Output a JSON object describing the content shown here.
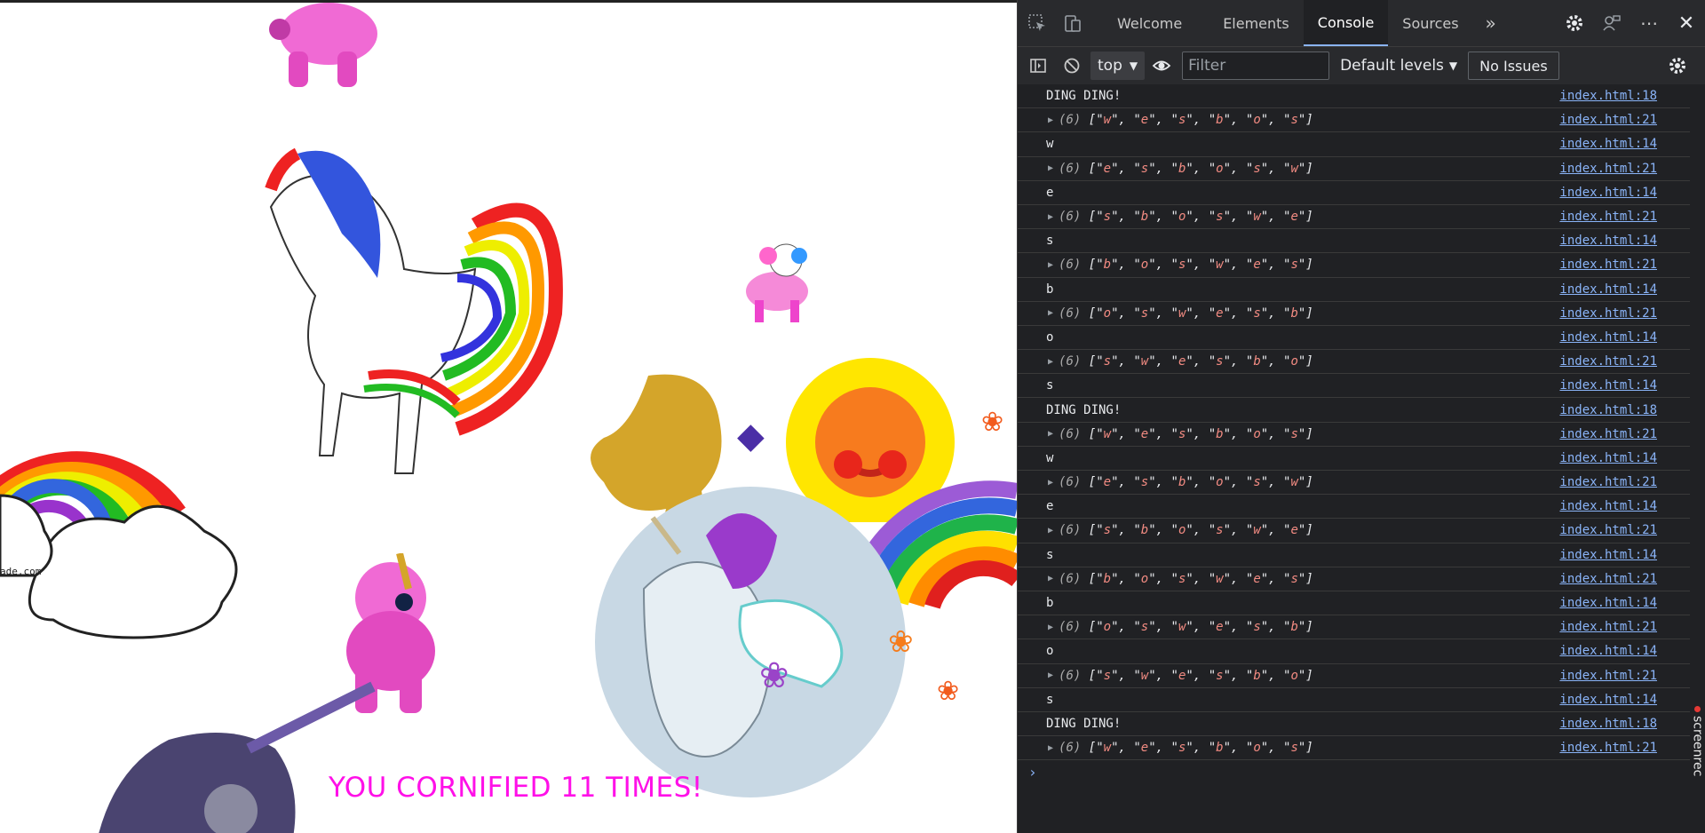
{
  "page": {
    "message": "YOU CORNIFIED 11 TIMES!",
    "artwork_text": "ade.com"
  },
  "devtools": {
    "tabs": [
      "Welcome",
      "Elements",
      "Console",
      "Sources"
    ],
    "active_tab": "Console",
    "more_tabs_icon": "chevron-double-right-icon",
    "toolbar": {
      "context": "top",
      "filter_placeholder": "Filter",
      "levels": "Default levels",
      "issues": "No Issues"
    },
    "messages": [
      {
        "type": "log",
        "text": "DING DING!",
        "src": "index.html:18"
      },
      {
        "type": "array",
        "text": [
          "w",
          "e",
          "s",
          "b",
          "o",
          "s"
        ],
        "src": "index.html:21"
      },
      {
        "type": "log",
        "text": "w",
        "src": "index.html:14"
      },
      {
        "type": "array",
        "text": [
          "e",
          "s",
          "b",
          "o",
          "s",
          "w"
        ],
        "src": "index.html:21"
      },
      {
        "type": "log",
        "text": "e",
        "src": "index.html:14"
      },
      {
        "type": "array",
        "text": [
          "s",
          "b",
          "o",
          "s",
          "w",
          "e"
        ],
        "src": "index.html:21"
      },
      {
        "type": "log",
        "text": "s",
        "src": "index.html:14"
      },
      {
        "type": "array",
        "text": [
          "b",
          "o",
          "s",
          "w",
          "e",
          "s"
        ],
        "src": "index.html:21"
      },
      {
        "type": "log",
        "text": "b",
        "src": "index.html:14"
      },
      {
        "type": "array",
        "text": [
          "o",
          "s",
          "w",
          "e",
          "s",
          "b"
        ],
        "src": "index.html:21"
      },
      {
        "type": "log",
        "text": "o",
        "src": "index.html:14"
      },
      {
        "type": "array",
        "text": [
          "s",
          "w",
          "e",
          "s",
          "b",
          "o"
        ],
        "src": "index.html:21"
      },
      {
        "type": "log",
        "text": "s",
        "src": "index.html:14"
      },
      {
        "type": "log",
        "text": "DING DING!",
        "src": "index.html:18"
      },
      {
        "type": "array",
        "text": [
          "w",
          "e",
          "s",
          "b",
          "o",
          "s"
        ],
        "src": "index.html:21"
      },
      {
        "type": "log",
        "text": "w",
        "src": "index.html:14"
      },
      {
        "type": "array",
        "text": [
          "e",
          "s",
          "b",
          "o",
          "s",
          "w"
        ],
        "src": "index.html:21"
      },
      {
        "type": "log",
        "text": "e",
        "src": "index.html:14"
      },
      {
        "type": "array",
        "text": [
          "s",
          "b",
          "o",
          "s",
          "w",
          "e"
        ],
        "src": "index.html:21"
      },
      {
        "type": "log",
        "text": "s",
        "src": "index.html:14"
      },
      {
        "type": "array",
        "text": [
          "b",
          "o",
          "s",
          "w",
          "e",
          "s"
        ],
        "src": "index.html:21"
      },
      {
        "type": "log",
        "text": "b",
        "src": "index.html:14"
      },
      {
        "type": "array",
        "text": [
          "o",
          "s",
          "w",
          "e",
          "s",
          "b"
        ],
        "src": "index.html:21"
      },
      {
        "type": "log",
        "text": "o",
        "src": "index.html:14"
      },
      {
        "type": "array",
        "text": [
          "s",
          "w",
          "e",
          "s",
          "b",
          "o"
        ],
        "src": "index.html:21"
      },
      {
        "type": "log",
        "text": "s",
        "src": "index.html:14"
      },
      {
        "type": "log",
        "text": "DING DING!",
        "src": "index.html:18"
      },
      {
        "type": "array",
        "text": [
          "w",
          "e",
          "s",
          "b",
          "o",
          "s"
        ],
        "src": "index.html:21"
      }
    ],
    "watermark": "screenrec",
    "colors": {
      "accent": "#8ab4f8",
      "string": "#f28b82",
      "cornify_text": "#ff10e8"
    }
  }
}
